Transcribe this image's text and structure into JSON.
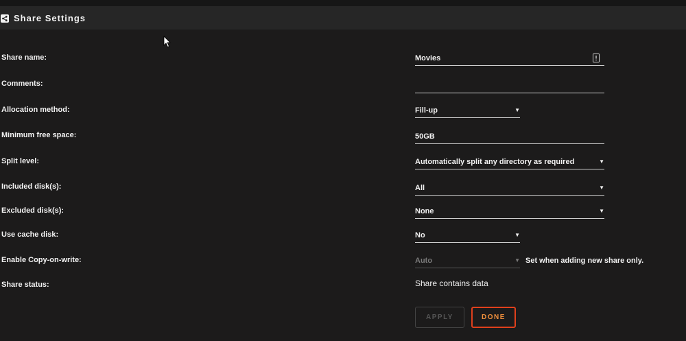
{
  "header": {
    "title": "Share Settings",
    "icon": "share-icon"
  },
  "fields": {
    "share_name": {
      "label": "Share name:",
      "value": "Movies"
    },
    "comments": {
      "label": "Comments:",
      "value": ""
    },
    "allocation_method": {
      "label": "Allocation method:",
      "value": "Fill-up"
    },
    "min_free_space": {
      "label": "Minimum free space:",
      "value": "50GB"
    },
    "split_level": {
      "label": "Split level:",
      "value": "Automatically split any directory as required"
    },
    "included_disks": {
      "label": "Included disk(s):",
      "value": "All"
    },
    "excluded_disks": {
      "label": "Excluded disk(s):",
      "value": "None"
    },
    "use_cache_disk": {
      "label": "Use cache disk:",
      "value": "No"
    },
    "copy_on_write": {
      "label": "Enable Copy-on-write:",
      "value": "Auto",
      "note": "Set when adding new share only."
    },
    "share_status": {
      "label": "Share status:",
      "value": "Share contains data"
    }
  },
  "buttons": {
    "apply": "APPLY",
    "done": "DONE"
  },
  "dropdown_arrow": "▼",
  "colors": {
    "background": "#1c1b1b",
    "header_bg": "#262626",
    "accent_border": "#e0401c",
    "accent_text": "#f1903d"
  }
}
